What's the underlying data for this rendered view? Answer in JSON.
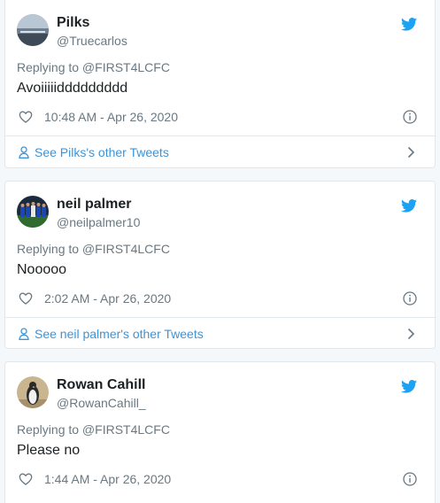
{
  "colors": {
    "twitter_blue": "#1da1f2",
    "link_blue": "#3b94d9",
    "meta_gray": "#697882",
    "text_dark": "#1c2022"
  },
  "tweets": [
    {
      "name": "Pilks",
      "handle": "@Truecarlos",
      "reply_to": "Replying to @FIRST4LCFC",
      "text": "Avoiiiiiddddddddd",
      "time": "10:48 AM - Apr 26, 2020",
      "other_tweets": "See Pilks's other Tweets",
      "avatar_icon": "landscape-avatar"
    },
    {
      "name": "neil palmer",
      "handle": "@neilpalmer10",
      "reply_to": "Replying to @FIRST4LCFC",
      "text": "Nooooo",
      "time": "2:02 AM - Apr 26, 2020",
      "other_tweets": "See neil palmer's other Tweets",
      "avatar_icon": "team-photo-avatar"
    },
    {
      "name": "Rowan Cahill",
      "handle": "@RowanCahill_",
      "reply_to": "Replying to @FIRST4LCFC",
      "text": "Please no",
      "time": "1:44 AM - Apr 26, 2020",
      "avatar_icon": "penguin-avatar"
    }
  ]
}
